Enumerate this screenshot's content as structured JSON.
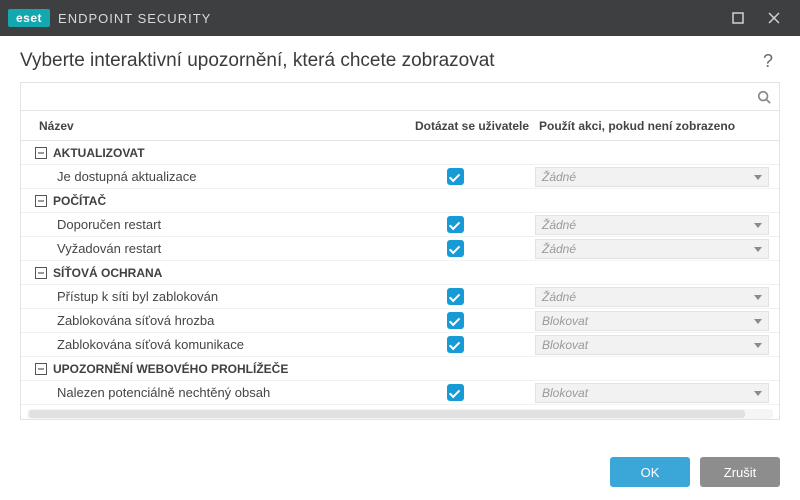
{
  "titlebar": {
    "brand_badge": "eset",
    "brand_text": "ENDPOINT SECURITY"
  },
  "page_title": "Vyberte interaktivní upozornění, která chcete zobrazovat",
  "search": {
    "placeholder": ""
  },
  "columns": {
    "name": "Název",
    "ask": "Dotázat se uživatele",
    "action": "Použít akci, pokud není zobrazeno"
  },
  "groups": [
    {
      "label": "AKTUALIZOVAT",
      "items": [
        {
          "name": "Je dostupná aktualizace",
          "checked": true,
          "action": "Žádné"
        }
      ]
    },
    {
      "label": "POČÍTAČ",
      "items": [
        {
          "name": "Doporučen restart",
          "checked": true,
          "action": "Žádné"
        },
        {
          "name": "Vyžadován restart",
          "checked": true,
          "action": "Žádné"
        }
      ]
    },
    {
      "label": "SÍŤOVÁ OCHRANA",
      "items": [
        {
          "name": "Přístup k síti byl zablokován",
          "checked": true,
          "action": "Žádné"
        },
        {
          "name": "Zablokována síťová hrozba",
          "checked": true,
          "action": "Blokovat"
        },
        {
          "name": "Zablokována síťová komunikace",
          "checked": true,
          "action": "Blokovat"
        }
      ]
    },
    {
      "label": "UPOZORNĚNÍ WEBOVÉHO PROHLÍŽEČE",
      "items": [
        {
          "name": "Nalezen potenciálně nechtěný obsah",
          "checked": true,
          "action": "Blokovat"
        }
      ]
    }
  ],
  "footer": {
    "ok": "OK",
    "cancel": "Zrušit"
  }
}
